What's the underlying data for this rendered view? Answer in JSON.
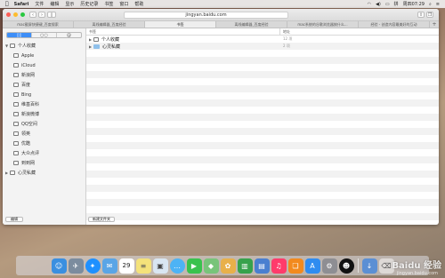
{
  "menubar": {
    "apple": "",
    "app": "Safari",
    "items": [
      "文件",
      "编辑",
      "显示",
      "历史记录",
      "书签",
      "窗口",
      "帮助"
    ],
    "clock": "周四07:29"
  },
  "toolbar": {
    "back": "‹",
    "forward": "›",
    "url": "jingyan.baidu.com"
  },
  "tabs": [
    "mac截屏快捷键_百度搜索",
    "离线编辑器_百度经验",
    "书签",
    "离线编辑器_百度经验",
    "mac系统的谷歌浏览器按什么...",
    "经验 - 创造内容最美好的互动"
  ],
  "sidebar": {
    "segments": [
      "▯▯",
      "○○",
      "@"
    ],
    "group1": "个人收藏",
    "children": [
      "Apple",
      "iCloud",
      "新浪网",
      "百度",
      "Bing",
      "维基百科",
      "新浪微博",
      "QQ空间",
      "领英",
      "优酷",
      "大众点评",
      "到到网"
    ],
    "group2": "心灵私藏",
    "edit_label": "编辑"
  },
  "main": {
    "col_title": "书签",
    "col_address": "地址",
    "rows": [
      {
        "name": "个人收藏",
        "addr": "12 项"
      },
      {
        "name": "心灵私藏",
        "addr": "2 项"
      }
    ],
    "new_folder": "新建文件夹"
  },
  "dock": {
    "icons": [
      "finder-icon",
      "launchpad-icon",
      "safari-icon",
      "mail-icon",
      "calendar-icon",
      "notes-icon",
      "preview-icon",
      "messages-icon",
      "facetime-icon",
      "maps-icon",
      "photos-icon",
      "numbers-icon",
      "keynote-icon",
      "itunes-icon",
      "ibooks-icon",
      "app-store-icon",
      "system-preferences-icon",
      "qq-icon",
      "downloads-icon",
      "trash-icon"
    ],
    "calendar_day": "29"
  },
  "watermark": {
    "main": "Baidu 经验",
    "sub": "jingyan.baidu.com"
  }
}
